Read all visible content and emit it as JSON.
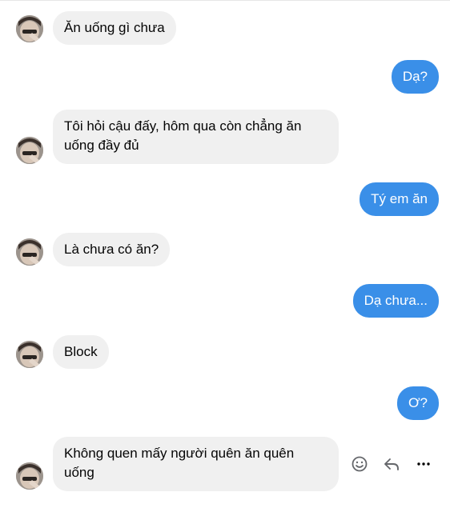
{
  "colors": {
    "outgoing_bubble": "#3a8fe8",
    "incoming_bubble": "#f0f0f0",
    "icon": "#65676b"
  },
  "messages": [
    {
      "direction": "incoming",
      "text": "Ăn uống gì chưa"
    },
    {
      "direction": "outgoing",
      "text": "Dạ?"
    },
    {
      "direction": "incoming",
      "text": "Tôi hỏi cậu đấy, hôm qua còn chẳng ăn uống đầy đủ"
    },
    {
      "direction": "outgoing",
      "text": "Tý em ăn"
    },
    {
      "direction": "incoming",
      "text": "Là chưa có ăn?"
    },
    {
      "direction": "outgoing",
      "text": "Dạ chưa..."
    },
    {
      "direction": "incoming",
      "text": "Block"
    },
    {
      "direction": "outgoing",
      "text": "Ơ?"
    },
    {
      "direction": "incoming",
      "text": "Không quen mấy người quên ăn quên uống"
    }
  ],
  "message_actions": [
    {
      "icon": "smiley-react-icon"
    },
    {
      "icon": "reply-arrow-icon"
    },
    {
      "icon": "more-dots-icon"
    }
  ]
}
